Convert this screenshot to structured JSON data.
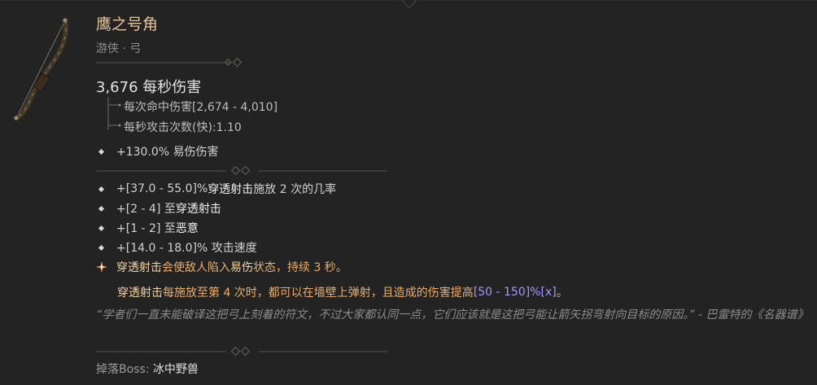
{
  "item": {
    "name": "鹰之号角",
    "type": "游侠 · 弓",
    "icon": "bow-icon"
  },
  "damage": {
    "dps": "3,676 每秒伤害",
    "per_hit": "每次命中伤害[2,674 - 4,010]",
    "attack_speed": "每秒攻击次数(快):1.10"
  },
  "implicit": {
    "text": "+130.0% 易伤伤害"
  },
  "affixes": [
    {
      "prefix": "+[37.0 - 55.0]% ",
      "highlight": "穿透射击",
      "suffix": " 施放 2 次的几率"
    },
    {
      "prefix": "+[2 - 4] 至",
      "highlight": "穿透射击",
      "suffix": ""
    },
    {
      "prefix": "+[1 - 2] 至",
      "highlight": "恶意",
      "suffix": ""
    },
    {
      "prefix": "+[14.0 - 18.0]% 攻击速度",
      "highlight": "",
      "suffix": ""
    }
  ],
  "legendary": {
    "skill": "穿透射击",
    "text1": "会使敌人陷入",
    "status": "易伤",
    "text2": "状态，持续 3 秒。"
  },
  "unique_power": {
    "skill": "穿透射击",
    "text": " 每施放至第 4 次时，都可以在墙壁上弹射，且造成的伤害提高 ",
    "range": "[50 - 150]%[x]",
    "end": "。"
  },
  "flavor": {
    "text": "“学者们一直未能破译这把弓上刻着的符文，不过大家都认同一点，它们应该就是这把弓能让箭矢拐弯射向目标的原因。” - 巴雷特的《名器谱》"
  },
  "drop": {
    "label": "掉落Boss: ",
    "boss": "冰中野兽"
  },
  "colors": {
    "background": "#232323",
    "name": "#e6c698",
    "legendary": "#e8ad6e",
    "range": "#9d9aff"
  }
}
